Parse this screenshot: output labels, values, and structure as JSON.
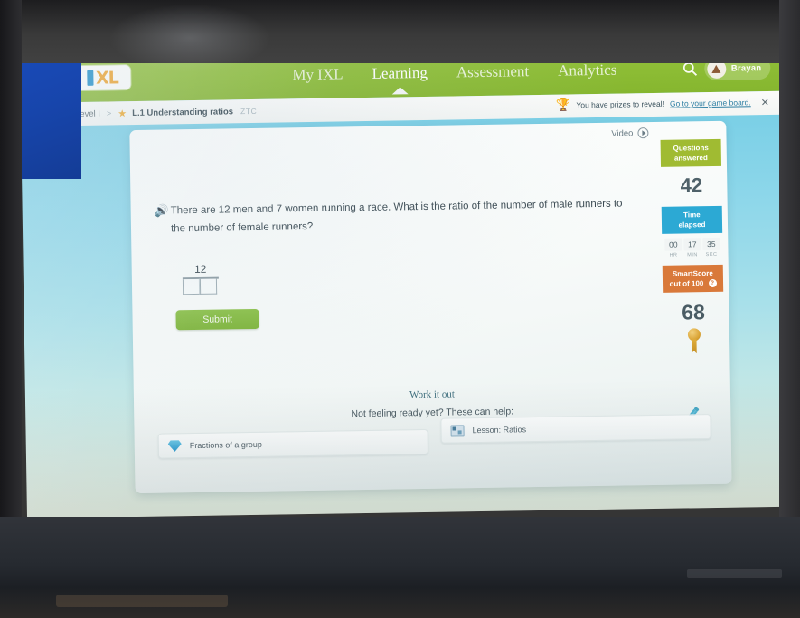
{
  "app": {
    "name": "IXL",
    "logo_text": "XL",
    "brand_green": "#8cbc34",
    "brand_blue": "#2ca9d4",
    "brand_orange": "#d9793a"
  },
  "nav": {
    "items": [
      {
        "label": "My IXL",
        "active": false
      },
      {
        "label": "Learning",
        "active": true
      },
      {
        "label": "Assessment",
        "active": false
      },
      {
        "label": "Analytics",
        "active": false
      }
    ],
    "search_icon": "search-icon",
    "user": {
      "name": "Brayan",
      "avatar_icon": "avatar-icon"
    }
  },
  "breadcrumb": {
    "level": "Level I",
    "separator": ">",
    "star_icon": "star-icon",
    "skill": "L.1 Understanding ratios",
    "code": "ZTC"
  },
  "banner": {
    "trophy_icon": "trophy-icon",
    "text": "You have prizes to reveal!",
    "link": "Go to your game board.",
    "close_icon": "close-icon"
  },
  "practice": {
    "video_label": "Video",
    "video_icon": "play-circle-icon",
    "speaker_icon": "speaker-icon",
    "question": "There are 12 men and 7 women running a race. What is the ratio of the number of male runners to the number of female runners?",
    "answer": {
      "numerator": "12",
      "denominator_boxes": [
        "",
        ""
      ],
      "placeholder": ""
    },
    "submit_label": "Submit",
    "pencil_icon": "pencil-icon"
  },
  "stats": {
    "questions": {
      "title_line1": "Questions",
      "title_line2": "answered",
      "value": "42"
    },
    "time": {
      "title_line1": "Time",
      "title_line2": "elapsed",
      "segments": [
        {
          "value": "00",
          "unit": "HR"
        },
        {
          "value": "17",
          "unit": "MIN"
        },
        {
          "value": "35",
          "unit": "SEC"
        }
      ]
    },
    "smartscore": {
      "title_line1": "SmartScore",
      "title_line2": "out of 100",
      "help_icon": "question-mark-icon",
      "help_label": "?",
      "value": "68",
      "medal_icon": "medal-icon"
    }
  },
  "help": {
    "heading": "Work it out",
    "subheading": "Not feeling ready yet? These can help:",
    "cards": [
      {
        "label": "Fractions of a group",
        "icon": "gem-icon"
      },
      {
        "label": "Lesson: Ratios",
        "icon": "lesson-card-icon"
      }
    ]
  }
}
